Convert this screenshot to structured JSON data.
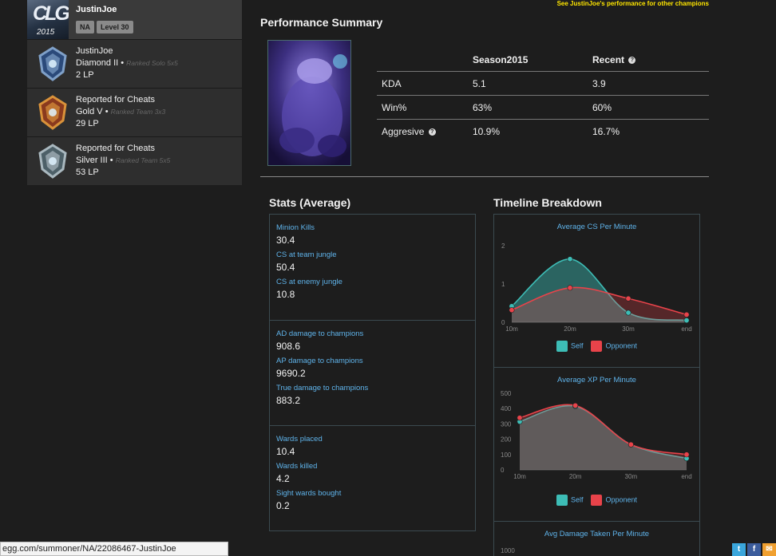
{
  "sidebar": {
    "profile": {
      "logo_mark": "CLG",
      "logo_year": "2015",
      "name": "JustinJoe",
      "tags": [
        "NA",
        "Level 30"
      ]
    },
    "ranks": [
      {
        "title": "JustinJoe",
        "tier": "Diamond II",
        "queue": "Ranked Solo 5x5",
        "lp": "2 LP",
        "colors": [
          "#7fa0c8",
          "#2b4a7a"
        ]
      },
      {
        "title": "Reported for Cheats",
        "tier": "Gold V",
        "queue": "Ranked Team 3x3",
        "lp": "29 LP",
        "colors": [
          "#d9923a",
          "#8a3a1e"
        ]
      },
      {
        "title": "Reported for Cheats",
        "tier": "Silver III",
        "queue": "Ranked Team 5x5",
        "lp": "53 LP",
        "colors": [
          "#a9b8bf",
          "#4d6068"
        ]
      }
    ]
  },
  "top_link": "See JustinJoe's performance for other champions",
  "performance": {
    "title": "Performance Summary",
    "columns": [
      "",
      "Season2015",
      "Recent"
    ],
    "rows": [
      {
        "label": "KDA",
        "season": "5.1",
        "recent": "3.9"
      },
      {
        "label": "Win%",
        "season": "63%",
        "recent": "60%"
      },
      {
        "label": "Aggresive",
        "season": "10.9%",
        "recent": "16.7%"
      }
    ]
  },
  "stats": {
    "title": "Stats (Average)",
    "groups": [
      [
        {
          "label": "Minion Kills",
          "value": "30.4"
        },
        {
          "label": "CS at team jungle",
          "value": "50.4"
        },
        {
          "label": "CS at enemy jungle",
          "value": "10.8"
        }
      ],
      [
        {
          "label": "AD damage to champions",
          "value": "908.6"
        },
        {
          "label": "AP damage to champions",
          "value": "9690.2"
        },
        {
          "label": "True damage to champions",
          "value": "883.2"
        }
      ],
      [
        {
          "label": "Wards placed",
          "value": "10.4"
        },
        {
          "label": "Wards killed",
          "value": "4.2"
        },
        {
          "label": "Sight wards bought",
          "value": "0.2"
        }
      ]
    ]
  },
  "timeline": {
    "title": "Timeline Breakdown",
    "legend": {
      "self": "Self",
      "opponent": "Opponent"
    },
    "colors": {
      "self": "#3dbdb6",
      "opponent": "#e8434a"
    }
  },
  "chart_data": [
    {
      "type": "area",
      "title": "Average CS Per Minute",
      "x": [
        "10m",
        "20m",
        "30m",
        "end"
      ],
      "ylim": [
        0,
        2
      ],
      "yticks": [
        "0",
        "1",
        "2"
      ],
      "series": [
        {
          "name": "Self",
          "values": [
            0.42,
            1.65,
            0.25,
            0.05
          ]
        },
        {
          "name": "Opponent",
          "values": [
            0.32,
            0.9,
            0.62,
            0.2
          ]
        }
      ]
    },
    {
      "type": "area",
      "title": "Average XP Per Minute",
      "x": [
        "10m",
        "20m",
        "30m",
        "end"
      ],
      "ylim": [
        0,
        500
      ],
      "yticks": [
        "0",
        "100",
        "200",
        "300",
        "400",
        "500"
      ],
      "series": [
        {
          "name": "Self",
          "values": [
            315,
            415,
            165,
            75
          ]
        },
        {
          "name": "Opponent",
          "values": [
            340,
            420,
            165,
            100
          ]
        }
      ]
    },
    {
      "type": "area",
      "title": "Avg Damage Taken Per Minute",
      "yticks": [
        "1000"
      ]
    }
  ],
  "status_url": "egg.com/summoner/NA/22086467-JustinJoe",
  "share": [
    {
      "icon": "twitter-icon",
      "glyph": "t",
      "color": "#3aa6dc"
    },
    {
      "icon": "facebook-icon",
      "glyph": "f",
      "color": "#3b5c9c"
    },
    {
      "icon": "share-icon",
      "glyph": "✉",
      "color": "#f0a030"
    }
  ]
}
